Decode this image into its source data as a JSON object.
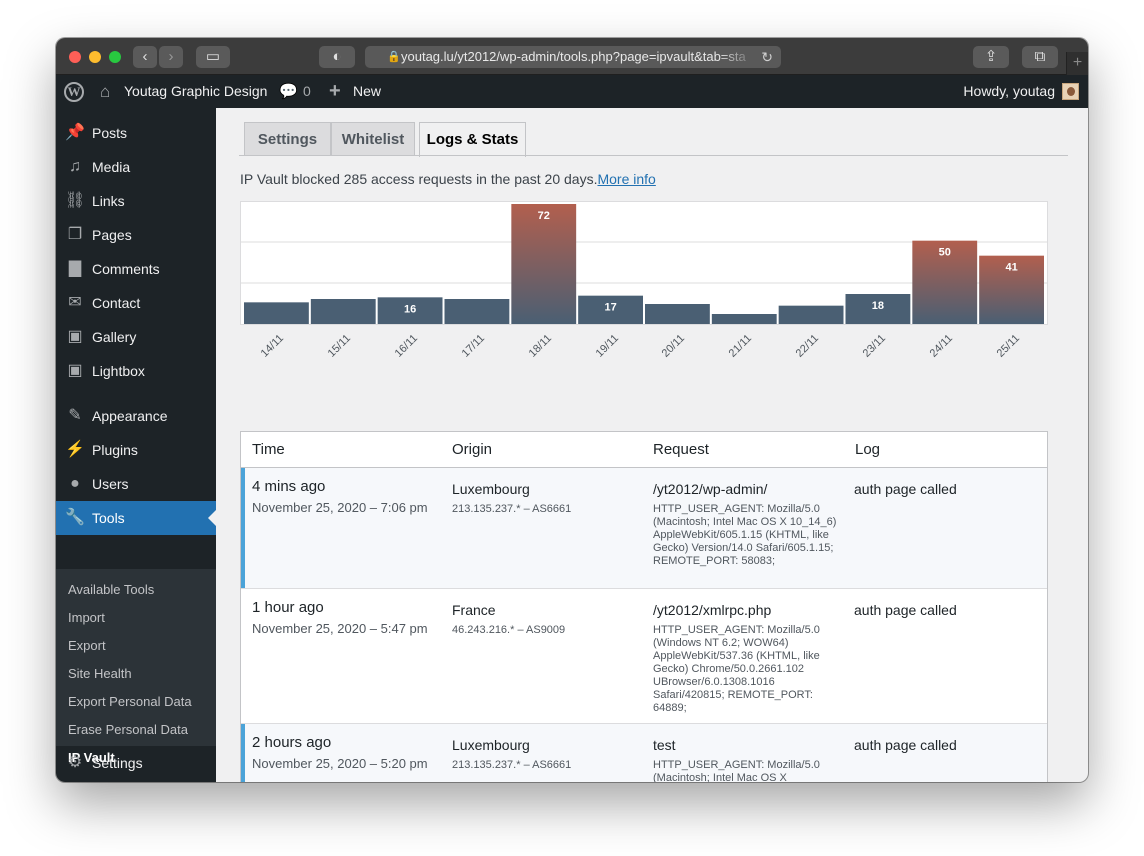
{
  "browser": {
    "url": "youtag.lu/yt2012/wp-admin/tools.php?page=ipvault&tab=sta",
    "back_icon": "chevron-left-icon",
    "forward_icon": "chevron-right-icon"
  },
  "adminbar": {
    "site_name": "Youtag Graphic Design",
    "comments_count": "0",
    "new_label": "New",
    "howdy": "Howdy, youtag"
  },
  "sidebar": {
    "items": [
      {
        "label": "Posts",
        "icon": "pushpin-icon"
      },
      {
        "label": "Media",
        "icon": "media-icon"
      },
      {
        "label": "Links",
        "icon": "link-icon"
      },
      {
        "label": "Pages",
        "icon": "pages-icon"
      },
      {
        "label": "Comments",
        "icon": "comment-icon"
      },
      {
        "label": "Contact",
        "icon": "envelope-icon"
      },
      {
        "label": "Gallery",
        "icon": "gallery-icon"
      },
      {
        "label": "Lightbox",
        "icon": "lightbox-icon"
      },
      {
        "label": "Appearance",
        "icon": "paintbrush-icon"
      },
      {
        "label": "Plugins",
        "icon": "plugin-icon"
      },
      {
        "label": "Users",
        "icon": "user-icon"
      },
      {
        "label": "Tools",
        "icon": "wrench-icon"
      },
      {
        "label": "Settings",
        "icon": "settings-icon"
      }
    ],
    "submenu": [
      "Available Tools",
      "Import",
      "Export",
      "Site Health",
      "Export Personal Data",
      "Erase Personal Data",
      "IP Vault"
    ]
  },
  "tabs": [
    "Settings",
    "Whitelist",
    "Logs & Stats"
  ],
  "summary": {
    "text": "IP Vault blocked 285 access requests in the past 20 days.",
    "link": "More info"
  },
  "chart_data": {
    "type": "bar",
    "categories": [
      "14/11",
      "15/11",
      "16/11",
      "17/11",
      "18/11",
      "19/11",
      "20/11",
      "21/11",
      "22/11",
      "23/11",
      "24/11",
      "25/11"
    ],
    "values": [
      13,
      15,
      16,
      15,
      72,
      17,
      12,
      6,
      11,
      18,
      50,
      41
    ],
    "data_labels": [
      "",
      "",
      "16",
      "",
      "72",
      "17",
      "",
      "",
      "",
      "18",
      "50",
      "41"
    ],
    "ylim": [
      0,
      72
    ],
    "colors": {
      "low": "#4a5f73",
      "high": "#b25f4e"
    }
  },
  "table": {
    "headers": [
      "Time",
      "Origin",
      "Request",
      "Log"
    ],
    "rows": [
      {
        "time": "4 mins ago",
        "date": "November 25, 2020 – 7:06 pm",
        "origin": "Luxembourg",
        "ip": "213.135.237.* – AS6661",
        "request": "/yt2012/wp-admin/",
        "agent": "HTTP_USER_AGENT: Mozilla/5.0 (Macintosh; Intel Mac OS X 10_14_6) AppleWebKit/605.1.15 (KHTML, like Gecko) Version/14.0 Safari/605.1.15; REMOTE_PORT: 58083;",
        "log": "auth page called"
      },
      {
        "time": "1 hour ago",
        "date": "November 25, 2020 – 5:47 pm",
        "origin": "France",
        "ip": "46.243.216.* – AS9009",
        "request": "/yt2012/xmlrpc.php",
        "agent": "HTTP_USER_AGENT: Mozilla/5.0 (Windows NT 6.2; WOW64) AppleWebKit/537.36 (KHTML, like Gecko) Chrome/50.0.2661.102 UBrowser/6.0.1308.1016 Safari/420815; REMOTE_PORT: 64889;",
        "log": "auth page called"
      },
      {
        "time": "2 hours ago",
        "date": "November 25, 2020 – 5:20 pm",
        "origin": "Luxembourg",
        "ip": "213.135.237.* – AS6661",
        "request": "test",
        "agent": "HTTP_USER_AGENT: Mozilla/5.0 (Macintosh; Intel Mac OS X",
        "log": "auth page called"
      }
    ]
  }
}
